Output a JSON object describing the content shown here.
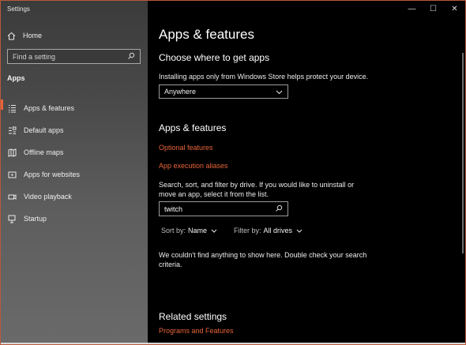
{
  "window": {
    "title": "Settings"
  },
  "controls": {
    "minimize": "—",
    "maximize": "☐",
    "close": "✕"
  },
  "sidebar": {
    "home": {
      "label": "Home",
      "icon": "home-icon"
    },
    "search": {
      "placeholder": "Find a setting",
      "value": ""
    },
    "section": "Apps",
    "items": [
      {
        "label": "Apps & features",
        "icon": "list-icon",
        "active": true
      },
      {
        "label": "Default apps",
        "icon": "default-apps-icon",
        "active": false
      },
      {
        "label": "Offline maps",
        "icon": "map-icon",
        "active": false
      },
      {
        "label": "Apps for websites",
        "icon": "link-icon",
        "active": false
      },
      {
        "label": "Video playback",
        "icon": "video-icon",
        "active": false
      },
      {
        "label": "Startup",
        "icon": "startup-icon",
        "active": false
      }
    ]
  },
  "main": {
    "title": "Apps & features",
    "choose": {
      "heading": "Choose where to get apps",
      "description": "Installing apps only from Windows Store helps protect your device.",
      "selected": "Anywhere"
    },
    "apps": {
      "heading": "Apps & features",
      "optional_features": "Optional features",
      "execution_aliases": "App execution aliases",
      "description_line1": "Search, sort, and filter by drive. If you would like to uninstall or",
      "description_line2": "move an app, select it from the list.",
      "search_value": "twitch",
      "sort_label": "Sort by:",
      "sort_value": "Name",
      "filter_label": "Filter by:",
      "filter_value": "All drives",
      "empty_line1": "We couldn't find anything to show here. Double check your search",
      "empty_line2": "criteria."
    },
    "related": {
      "heading": "Related settings",
      "programs": "Programs and Features"
    }
  },
  "colors": {
    "accent": "#e8643a",
    "background": "#000000",
    "sidebar": "#4a4a4a"
  }
}
